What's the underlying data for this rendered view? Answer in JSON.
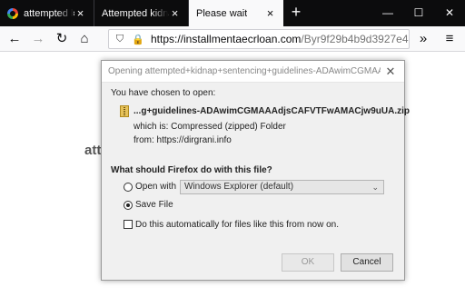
{
  "tabs": [
    {
      "label": "attempted kidnap",
      "favicon": "google-g-icon"
    },
    {
      "label": "Attempted kidnap sen",
      "favicon": ""
    },
    {
      "label": "Please wait",
      "favicon": ""
    }
  ],
  "tabstrip": {
    "new_tab": "+",
    "minimize": "—",
    "maximize": "☐",
    "close": "✕"
  },
  "nav": {
    "url_domain": "https://installmentaecrloan.com",
    "url_path": "/Byr9f29b4b9d3927e4",
    "back": "←",
    "forward": "→",
    "reload": "↻",
    "home": "⌂",
    "overflow": "»",
    "menu": "≡"
  },
  "page": {
    "heading_fragment": "att"
  },
  "dialog": {
    "title": "Opening attempted+kidnap+sentencing+guidelines-ADAwimCGMAAA...",
    "intro": "You have chosen to open:",
    "filename": "...g+guidelines-ADAwimCGMAAAdjsCAFVTFwAMACjw9uUA.zip",
    "which_is": "which is:  Compressed (zipped) Folder",
    "from": "from:  https://dirgrani.info",
    "question": "What should Firefox do with this file?",
    "open_with_label": "Open with",
    "open_with_app": "Windows Explorer (default)",
    "save_file_label": "Save File",
    "auto_label": "Do this automatically for files like this from now on.",
    "ok": "OK",
    "cancel": "Cancel"
  }
}
